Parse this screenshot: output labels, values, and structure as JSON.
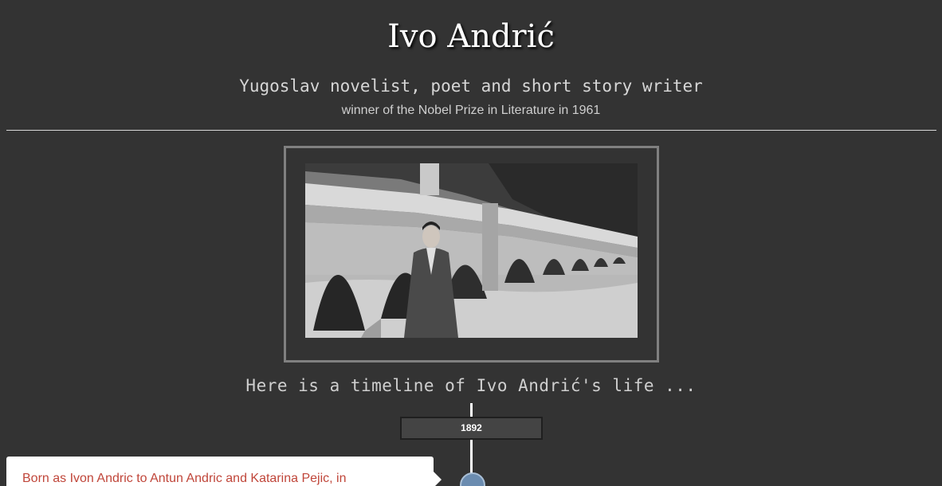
{
  "header": {
    "title": "Ivo Andrić",
    "subtitle": "Yugoslav novelist, poet and short story writer",
    "tagline": "winner of the Nobel Prize in Literature in 1961"
  },
  "timeline": {
    "intro": "Here is a timeline of Ivo Andrić's life ...",
    "events": [
      {
        "year": "1892",
        "text": "Born as Ivon Andric to Antun Andric and Katarina Pejic, in"
      }
    ]
  },
  "colors": {
    "background": "#333333",
    "event_text": "#c0463a",
    "timeline_dot": "#6b8cb0"
  }
}
